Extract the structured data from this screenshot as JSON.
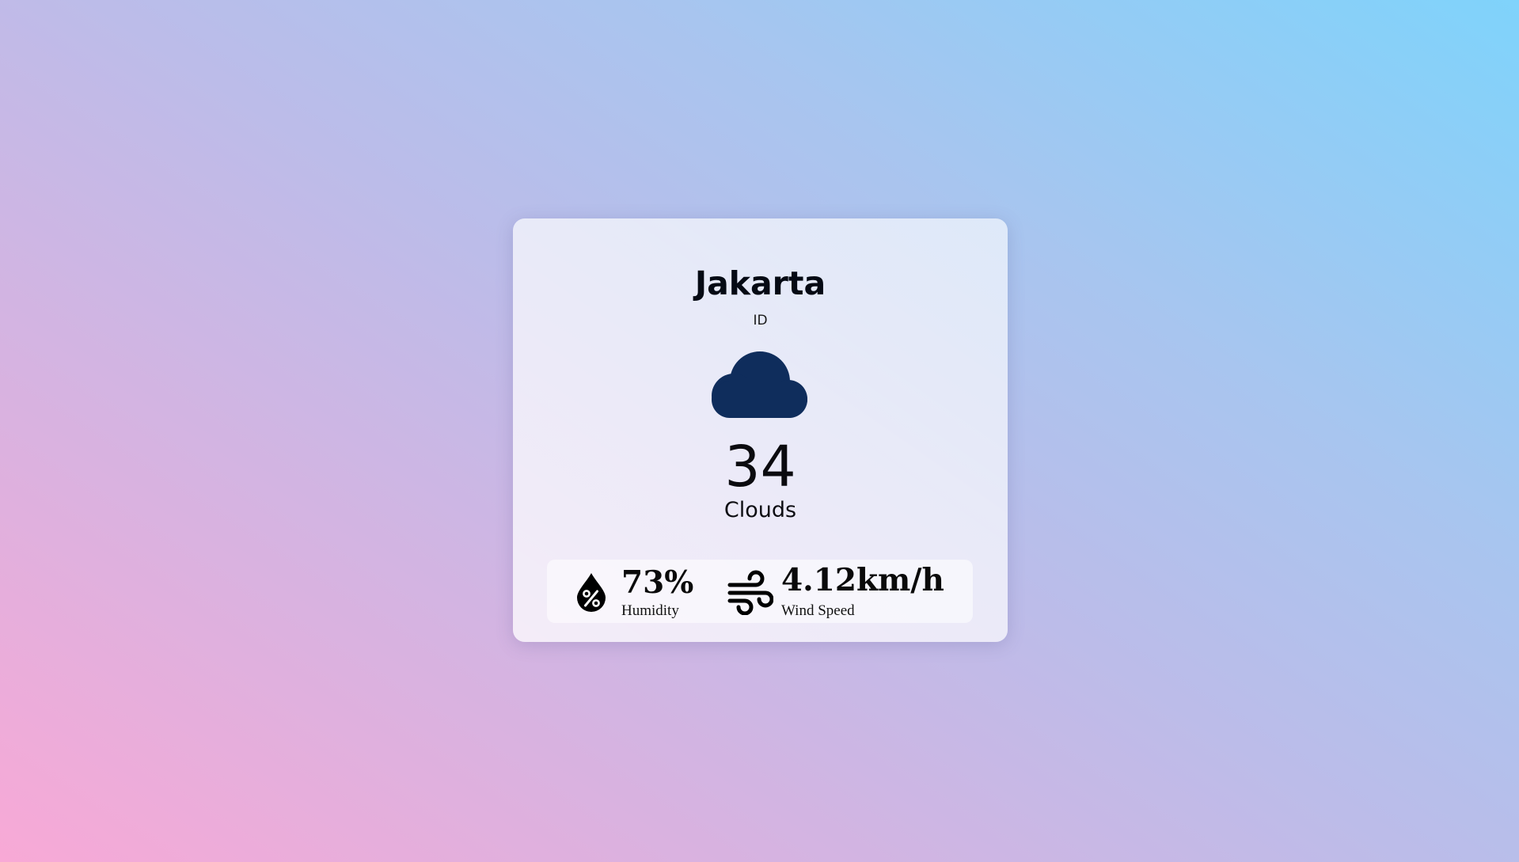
{
  "weather": {
    "city": "Jakarta",
    "country": "ID",
    "condition_icon": "cloud-icon",
    "temperature": "34",
    "description": "Clouds",
    "humidity": {
      "icon": "humidity-drop-icon",
      "value": "73%",
      "label": "Humidity"
    },
    "wind": {
      "icon": "wind-icon",
      "value": "4.12km/h",
      "label": "Wind Speed"
    }
  },
  "colors": {
    "cloud_icon": "#0f2d5c",
    "background_start": "#f8a9d6",
    "background_end": "#7fd3fb",
    "text": "#0a0a0a"
  }
}
